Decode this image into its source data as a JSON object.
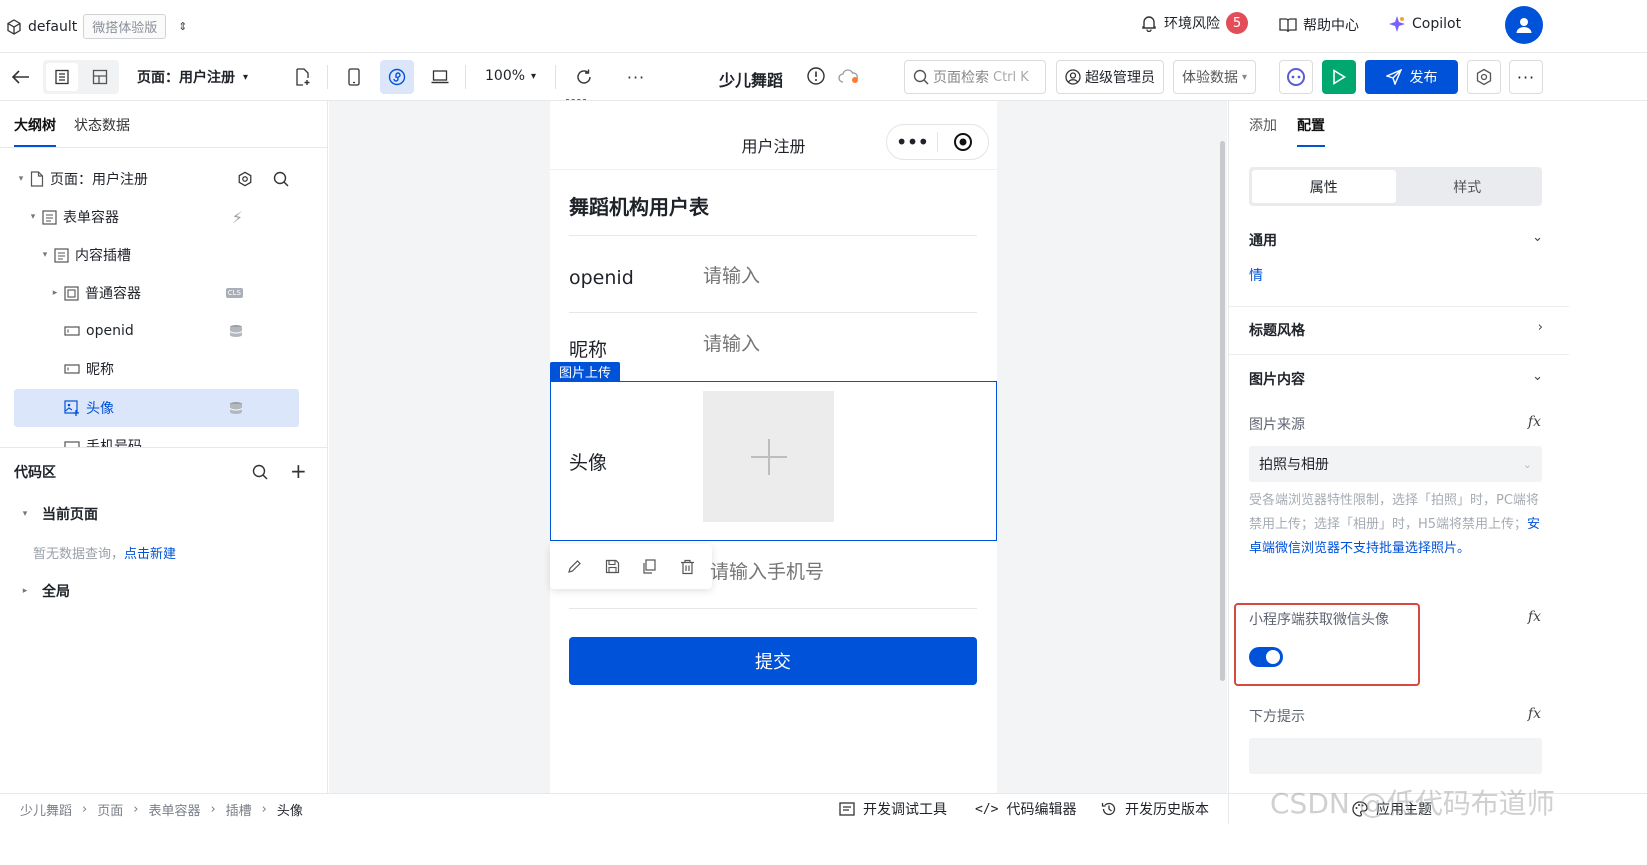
{
  "topbar": {
    "env_name": "default",
    "env_tag": "微搭体验版",
    "env_risk_label": "环境风险",
    "env_risk_count": "5",
    "help_label": "帮助中心",
    "copilot_label": "Copilot"
  },
  "toolbar": {
    "page_selector": "页面：用户注册",
    "zoom": "100%",
    "app_title": "少儿舞蹈",
    "search_label": "页面检索",
    "search_shortcut": "Ctrl K",
    "admin_label": "超级管理员",
    "data_label": "体验数据",
    "publish_label": "发布"
  },
  "left": {
    "tabs": [
      "大纲树",
      "状态数据"
    ],
    "tree": [
      {
        "label": "页面：用户注册",
        "level": 0
      },
      {
        "label": "表单容器",
        "level": 1
      },
      {
        "label": "内容插槽",
        "level": 2
      },
      {
        "label": "普通容器",
        "level": 3
      },
      {
        "label": "openid",
        "level": 3
      },
      {
        "label": "昵称",
        "level": 3
      },
      {
        "label": "头像",
        "level": 3
      },
      {
        "label": "手机号码",
        "level": 3
      }
    ],
    "code_title": "代码区",
    "current_page": "当前页面",
    "empty_hint": "暂无数据查询，",
    "create_link": "点击新建",
    "global": "全局"
  },
  "canvas": {
    "nav_title": "用户注册",
    "form_title": "舞蹈机构用户表",
    "openid_label": "openid",
    "openid_placeholder": "请输入",
    "nickname_label": "昵称",
    "nickname_placeholder": "请输入",
    "upload_tag": "图片上传",
    "avatar_label": "头像",
    "phone_placeholder": "请输入手机号",
    "submit_label": "提交"
  },
  "right": {
    "tabs": [
      "添加",
      "配置"
    ],
    "seg": [
      "属性",
      "样式"
    ],
    "general": "通用",
    "general_item": "情",
    "title_style": "标题风格",
    "image_content": "图片内容",
    "image_source_label": "图片来源",
    "image_source_value": "拍照与相册",
    "note_gray": "受各端浏览器特性限制，选择「拍照」时，PC端将禁用上传；选择「相册」时，H5端将禁用上传；",
    "note_blue": "安卓端微信浏览器不支持批量选择照片。",
    "wx_avatar_label": "小程序端获取微信头像",
    "bottom_hint_label": "下方提示",
    "fx": "fx"
  },
  "bottom": {
    "breadcrumb": [
      "少儿舞蹈",
      "页面",
      "表单容器",
      "插槽",
      "头像"
    ],
    "dev_tools": "开发调试工具",
    "code_editor": "代码编辑器",
    "history": "开发历史版本",
    "theme": "应用主题",
    "watermark": "CSDN @低代码布道师"
  },
  "colors": {
    "primary": "#0052d9",
    "publish_green": "#00a870",
    "badge": "#e34d59",
    "highlight_red": "#d54941"
  }
}
